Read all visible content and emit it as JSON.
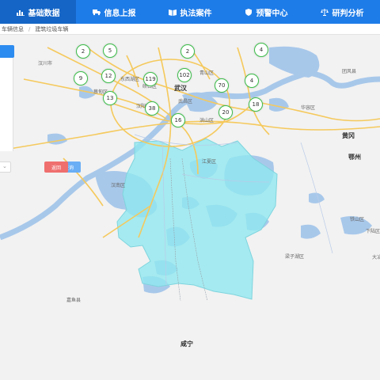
{
  "nav": {
    "items": [
      {
        "label": "基础数据",
        "icon": "bar-chart-icon",
        "active": true
      },
      {
        "label": "信息上报",
        "icon": "truck-icon",
        "active": false
      },
      {
        "label": "执法案件",
        "icon": "book-icon",
        "active": false
      },
      {
        "label": "预警中心",
        "icon": "shield-icon",
        "active": false
      },
      {
        "label": "研判分析",
        "icon": "scale-icon",
        "active": false
      }
    ]
  },
  "breadcrumb": {
    "items": [
      "车辆信息",
      "建筑垃圾车辆"
    ]
  },
  "panel": {
    "query_label": "查询",
    "back_label": "返回"
  },
  "map": {
    "places": [
      {
        "name": "汉川市"
      },
      {
        "name": "蔡甸区"
      },
      {
        "name": "东西湖区"
      },
      {
        "name": "硚口区"
      },
      {
        "name": "武汉"
      },
      {
        "name": "汉阳区"
      },
      {
        "name": "武昌区"
      },
      {
        "name": "洪山区"
      },
      {
        "name": "青山区"
      },
      {
        "name": "团风县"
      },
      {
        "name": "华容区"
      },
      {
        "name": "黄冈"
      },
      {
        "name": "鄂州"
      },
      {
        "name": "江夏区"
      },
      {
        "name": "汉南区"
      },
      {
        "name": "铁山区"
      },
      {
        "name": "梁子湖区"
      },
      {
        "name": "下陆区"
      },
      {
        "name": "大冶"
      },
      {
        "name": "嘉鱼县"
      },
      {
        "name": "咸宁"
      }
    ],
    "clusters": [
      2,
      5,
      2,
      4,
      9,
      12,
      119,
      102,
      70,
      4,
      13,
      38,
      18,
      20,
      16
    ],
    "colors": {
      "cluster_border": "#3cbf4a",
      "district_fill": "#8fe8f0",
      "water": "#a8c8ea",
      "road": "#f5c95c"
    }
  }
}
